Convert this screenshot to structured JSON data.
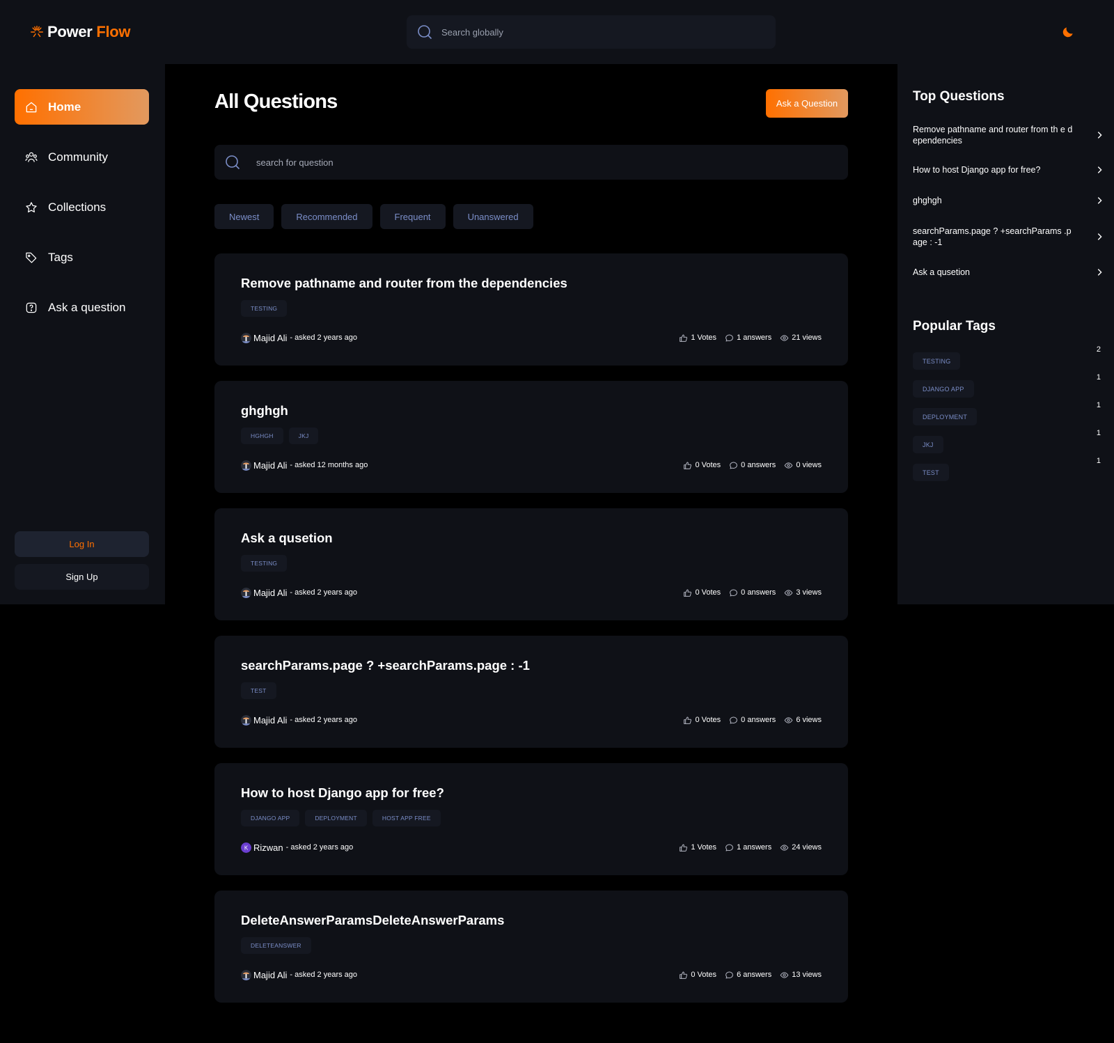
{
  "header": {
    "logo_word1": "Power",
    "logo_word2": "Flow",
    "search_placeholder": "Search globally"
  },
  "sidebar": {
    "items": [
      {
        "label": "Home",
        "icon": "home-icon",
        "active": true
      },
      {
        "label": "Community",
        "icon": "community-icon",
        "active": false
      },
      {
        "label": "Collections",
        "icon": "star-icon",
        "active": false
      },
      {
        "label": "Tags",
        "icon": "tag-icon",
        "active": false
      },
      {
        "label": "Ask a question",
        "icon": "question-icon",
        "active": false
      }
    ],
    "login_label": "Log In",
    "signup_label": "Sign Up"
  },
  "main": {
    "title": "All Questions",
    "ask_button": "Ask a Question",
    "search_placeholder": "search for question",
    "filters": [
      "Newest",
      "Recommended",
      "Frequent",
      "Unanswered"
    ],
    "questions": [
      {
        "title": "Remove pathname and router from the dependencies",
        "tags": [
          "TESTING"
        ],
        "author": "Majid Ali",
        "asked": "- asked 2 years ago",
        "votes": "1 Votes",
        "answers": "1 answers",
        "views": "21 views",
        "avatar": "photo"
      },
      {
        "title": "ghghgh",
        "tags": [
          "HGHGH",
          "JKJ"
        ],
        "author": "Majid Ali",
        "asked": "- asked 12 months ago",
        "votes": "0 Votes",
        "answers": "0 answers",
        "views": "0 views",
        "avatar": "photo"
      },
      {
        "title": "Ask a qusetion",
        "tags": [
          "TESTING"
        ],
        "author": "Majid Ali",
        "asked": "- asked 2 years ago",
        "votes": "0 Votes",
        "answers": "0 answers",
        "views": "3 views",
        "avatar": "photo"
      },
      {
        "title": "searchParams.page ? +searchParams.page : -1",
        "tags": [
          "TEST"
        ],
        "author": "Majid Ali",
        "asked": "- asked 2 years ago",
        "votes": "0 Votes",
        "answers": "0 answers",
        "views": "6 views",
        "avatar": "photo"
      },
      {
        "title": "How to host Django app for free?",
        "tags": [
          "DJANGO APP",
          "DEPLOYMENT",
          "HOST APP FREE"
        ],
        "author": "Rizwan",
        "asked": "- asked 2 years ago",
        "votes": "1 Votes",
        "answers": "1 answers",
        "views": "24 views",
        "avatar": "letter"
      },
      {
        "title": "DeleteAnswerParamsDeleteAnswerParams",
        "tags": [
          "DELETEANSWER"
        ],
        "author": "Majid Ali",
        "asked": "- asked 2 years ago",
        "votes": "0 Votes",
        "answers": "6 answers",
        "views": "13 views",
        "avatar": "photo"
      }
    ]
  },
  "rightbar": {
    "top_questions_heading": "Top Questions",
    "top_questions": [
      "Remove pathname and router from th e dependencies",
      "How to host Django app for free?",
      "ghghgh",
      "searchParams.page ? +searchParams .page : -1",
      "Ask a qusetion"
    ],
    "popular_tags_heading": "Popular Tags",
    "popular_tags": [
      {
        "name": "TESTING",
        "count": "2"
      },
      {
        "name": "DJANGO APP",
        "count": "1"
      },
      {
        "name": "DEPLOYMENT",
        "count": "1"
      },
      {
        "name": "JKJ",
        "count": "1"
      },
      {
        "name": "TEST",
        "count": "1"
      }
    ]
  },
  "colors": {
    "accent": "#ff7000",
    "accent_gradient_end": "#e2995f",
    "tag_text": "#7b8ec8",
    "panel": "#0f1117",
    "surface": "#151821"
  }
}
